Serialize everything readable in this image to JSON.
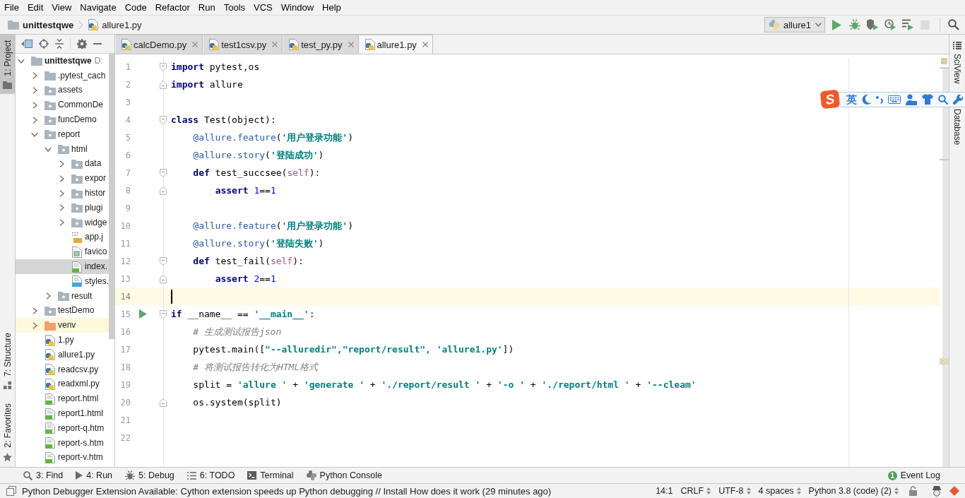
{
  "menu_bar": {
    "items": [
      "File",
      "Edit",
      "View",
      "Navigate",
      "Code",
      "Refactor",
      "Run",
      "Tools",
      "VCS",
      "Window",
      "Help"
    ]
  },
  "navigation_bar": {
    "breadcrumbs": [
      {
        "kind": "folder",
        "label": "unittestqwe"
      },
      {
        "kind": "python",
        "label": "allure1.py"
      }
    ],
    "run_configuration": {
      "label": "allure1"
    },
    "actions": [
      {
        "kind": "run",
        "disabled": false
      },
      {
        "kind": "debug",
        "disabled": false
      },
      {
        "kind": "coverage",
        "disabled": false
      },
      {
        "kind": "profile",
        "disabled": false
      },
      {
        "kind": "concurrency",
        "disabled": false
      },
      {
        "kind": "stop",
        "disabled": true
      },
      {
        "kind": "search",
        "disabled": false
      }
    ]
  },
  "left_stripe": [
    {
      "kind": "project",
      "label": "1: Project",
      "selected": true
    },
    {
      "kind": "structure",
      "label": "7: Structure",
      "selected": false
    },
    {
      "kind": "favorites",
      "label": "2: Favorites",
      "selected": false
    }
  ],
  "project_panel": {
    "tree": [
      {
        "kind": "folder",
        "label": "unittestqwe",
        "path": "D:",
        "expanded": true,
        "selected": false,
        "children": [
          {
            "kind": "folder",
            "label": ".pytest_cach",
            "expanded": false,
            "selected": false
          },
          {
            "kind": "package",
            "label": "assets",
            "expanded": false,
            "selected": false
          },
          {
            "kind": "package",
            "label": "CommonDe",
            "expanded": false,
            "selected": false
          },
          {
            "kind": "package",
            "label": "funcDemo",
            "expanded": false,
            "selected": false
          },
          {
            "kind": "package",
            "label": "report",
            "expanded": true,
            "selected": false,
            "children": [
              {
                "kind": "package",
                "label": "html",
                "expanded": true,
                "selected": false,
                "children": [
                  {
                    "kind": "package",
                    "label": "data",
                    "expanded": false,
                    "selected": false
                  },
                  {
                    "kind": "package",
                    "label": "expor",
                    "expanded": false,
                    "selected": false
                  },
                  {
                    "kind": "package",
                    "label": "histor",
                    "expanded": false,
                    "selected": false
                  },
                  {
                    "kind": "package",
                    "label": "plugi",
                    "expanded": false,
                    "selected": false
                  },
                  {
                    "kind": "package",
                    "label": "widge",
                    "expanded": false,
                    "selected": false
                  },
                  {
                    "kind": "js",
                    "label": "app.j",
                    "selected": false
                  },
                  {
                    "kind": "image",
                    "label": "favico",
                    "selected": false
                  },
                  {
                    "kind": "html",
                    "label": "index.",
                    "selected": true
                  },
                  {
                    "kind": "css",
                    "label": "styles.",
                    "selected": false
                  }
                ]
              },
              {
                "kind": "package",
                "label": "result",
                "expanded": false,
                "selected": false
              }
            ]
          },
          {
            "kind": "package",
            "label": "testDemo",
            "expanded": false,
            "selected": false
          },
          {
            "kind": "excluded",
            "label": "venv",
            "expanded": false,
            "selected": false
          },
          {
            "kind": "python",
            "label": "1.py",
            "selected": false
          },
          {
            "kind": "python",
            "label": "allure1.py",
            "selected": false
          },
          {
            "kind": "python",
            "label": "readcsv.py",
            "selected": false
          },
          {
            "kind": "python",
            "label": "readxml.py",
            "selected": false
          },
          {
            "kind": "html",
            "label": "report.html",
            "selected": false
          },
          {
            "kind": "html",
            "label": "report1.html",
            "selected": false
          },
          {
            "kind": "html",
            "label": "report-q.htm",
            "selected": false
          },
          {
            "kind": "html",
            "label": "report-s.htm",
            "selected": false
          },
          {
            "kind": "html",
            "label": "report-v.htm",
            "selected": false
          }
        ]
      }
    ]
  },
  "editor": {
    "tabs": [
      {
        "label": "calcDemo.py",
        "selected": false
      },
      {
        "label": "test1csv.py",
        "selected": false
      },
      {
        "label": "test_py.py",
        "selected": false
      },
      {
        "label": "allure1.py",
        "selected": true
      }
    ],
    "lines": [
      {
        "number": "1",
        "fold_start": true,
        "fold_end": false,
        "current": false,
        "runnable": false,
        "tokens": [
          {
            "kind": "keyword",
            "text": "import"
          },
          {
            "kind": "plain",
            "text": " pytest,os"
          }
        ]
      },
      {
        "number": "2",
        "fold_start": false,
        "fold_end": true,
        "current": false,
        "runnable": false,
        "tokens": [
          {
            "kind": "keyword",
            "text": "import"
          },
          {
            "kind": "plain",
            "text": " allure"
          }
        ]
      },
      {
        "number": "3",
        "fold_start": false,
        "fold_end": false,
        "current": false,
        "runnable": false
      },
      {
        "number": "4",
        "fold_start": true,
        "fold_end": false,
        "current": false,
        "runnable": false,
        "tokens": [
          {
            "kind": "keyword",
            "text": "class"
          },
          {
            "kind": "plain",
            "text": " Test(object):"
          }
        ]
      },
      {
        "number": "5",
        "fold_start": false,
        "fold_end": false,
        "current": false,
        "runnable": false,
        "tokens": [
          {
            "kind": "decorator",
            "text": "    @allure.feature"
          },
          {
            "kind": "plain",
            "text": "("
          },
          {
            "kind": "string",
            "text": "'用户登录功能'"
          },
          {
            "kind": "plain",
            "text": ")"
          }
        ]
      },
      {
        "number": "6",
        "fold_start": false,
        "fold_end": false,
        "current": false,
        "runnable": false,
        "tokens": [
          {
            "kind": "decorator",
            "text": "    @allure.story"
          },
          {
            "kind": "plain",
            "text": "("
          },
          {
            "kind": "string",
            "text": "'登陆成功'"
          },
          {
            "kind": "plain",
            "text": ")"
          }
        ]
      },
      {
        "number": "7",
        "fold_start": true,
        "fold_end": false,
        "current": false,
        "runnable": false,
        "tokens": [
          {
            "kind": "keyword",
            "text": "    def"
          },
          {
            "kind": "plain",
            "text": " test_succsee("
          },
          {
            "kind": "self",
            "text": "self"
          },
          {
            "kind": "plain",
            "text": "):"
          }
        ]
      },
      {
        "number": "8",
        "fold_start": false,
        "fold_end": true,
        "current": false,
        "runnable": false,
        "tokens": [
          {
            "kind": "keyword",
            "text": "        assert"
          },
          {
            "kind": "number",
            "text": " 1"
          },
          {
            "kind": "plain",
            "text": "=="
          },
          {
            "kind": "number",
            "text": "1"
          }
        ]
      },
      {
        "number": "9",
        "fold_start": false,
        "fold_end": false,
        "current": false,
        "runnable": false
      },
      {
        "number": "10",
        "fold_start": false,
        "fold_end": false,
        "current": false,
        "runnable": false,
        "tokens": [
          {
            "kind": "decorator",
            "text": "    @allure.feature"
          },
          {
            "kind": "plain",
            "text": "("
          },
          {
            "kind": "string",
            "text": "'用户登录功能'"
          },
          {
            "kind": "plain",
            "text": ")"
          }
        ]
      },
      {
        "number": "11",
        "fold_start": false,
        "fold_end": false,
        "current": false,
        "runnable": false,
        "tokens": [
          {
            "kind": "decorator",
            "text": "    @allure.story"
          },
          {
            "kind": "plain",
            "text": "("
          },
          {
            "kind": "string",
            "text": "'登陆失败'"
          },
          {
            "kind": "plain",
            "text": ")"
          }
        ]
      },
      {
        "number": "12",
        "fold_start": true,
        "fold_end": false,
        "current": false,
        "runnable": false,
        "tokens": [
          {
            "kind": "keyword",
            "text": "    def"
          },
          {
            "kind": "plain",
            "text": " test_fail("
          },
          {
            "kind": "self",
            "text": "self"
          },
          {
            "kind": "plain",
            "text": "):"
          }
        ]
      },
      {
        "number": "13",
        "fold_start": false,
        "fold_end": true,
        "current": false,
        "runnable": false,
        "tokens": [
          {
            "kind": "keyword",
            "text": "        assert"
          },
          {
            "kind": "number",
            "text": " 2"
          },
          {
            "kind": "plain",
            "text": "=="
          },
          {
            "kind": "number",
            "text": "1"
          }
        ]
      },
      {
        "number": "14",
        "fold_start": false,
        "fold_end": false,
        "current": true,
        "runnable": false
      },
      {
        "number": "15",
        "fold_start": true,
        "fold_end": false,
        "current": false,
        "runnable": true,
        "tokens": [
          {
            "kind": "keyword",
            "text": "if"
          },
          {
            "kind": "plain",
            "text": " __name__ == "
          },
          {
            "kind": "string",
            "text": "'__main__'"
          },
          {
            "kind": "plain",
            "text": ":"
          }
        ]
      },
      {
        "number": "16",
        "fold_start": false,
        "fold_end": false,
        "current": false,
        "runnable": false,
        "tokens": [
          {
            "kind": "comment",
            "text": "    # 生成测试报告json"
          }
        ]
      },
      {
        "number": "17",
        "fold_start": false,
        "fold_end": false,
        "current": false,
        "runnable": false,
        "tokens": [
          {
            "kind": "plain",
            "text": "    pytest.main(["
          },
          {
            "kind": "string",
            "text": "\"--alluredir\",\"report/result\", 'allure1.py'"
          },
          {
            "kind": "plain",
            "text": "])"
          }
        ]
      },
      {
        "number": "18",
        "fold_start": false,
        "fold_end": false,
        "current": false,
        "runnable": false,
        "tokens": [
          {
            "kind": "comment",
            "text": "    # 将测试报告转化为HTML格式"
          }
        ]
      },
      {
        "number": "19",
        "fold_start": false,
        "fold_end": false,
        "current": false,
        "runnable": false,
        "tokens": [
          {
            "kind": "plain",
            "text": "    split = "
          },
          {
            "kind": "string",
            "text": "'allure '"
          },
          {
            "kind": "plain",
            "text": " + "
          },
          {
            "kind": "string",
            "text": "'generate '"
          },
          {
            "kind": "plain",
            "text": " + "
          },
          {
            "kind": "string",
            "text": "'./report/result '"
          },
          {
            "kind": "plain",
            "text": " + "
          },
          {
            "kind": "string",
            "text": "'-o '"
          },
          {
            "kind": "plain",
            "text": " + "
          },
          {
            "kind": "string",
            "text": "'./report/html '"
          },
          {
            "kind": "plain",
            "text": " + "
          },
          {
            "kind": "string",
            "text": "'--cleam'"
          }
        ]
      },
      {
        "number": "20",
        "fold_start": false,
        "fold_end": true,
        "current": false,
        "runnable": false,
        "tokens": [
          {
            "kind": "plain",
            "text": "    os.system(split)"
          }
        ]
      },
      {
        "number": "21",
        "fold_start": false,
        "fold_end": false,
        "current": false,
        "runnable": false
      },
      {
        "number": "22",
        "fold_start": false,
        "fold_end": false,
        "current": false,
        "runnable": false
      }
    ]
  },
  "right_stripe": [
    {
      "kind": "sciview",
      "label": "SciView"
    },
    {
      "kind": "database",
      "label": "Database"
    }
  ],
  "ime_toolbar": {
    "logo": "S",
    "mode": "英"
  },
  "tool_window_bar": {
    "items": [
      {
        "kind": "find",
        "label": "3: Find"
      },
      {
        "kind": "run",
        "label": "4: Run"
      },
      {
        "kind": "debug",
        "label": "5: Debug"
      },
      {
        "kind": "todo",
        "label": "6: TODO"
      },
      {
        "kind": "terminal",
        "label": "Terminal"
      },
      {
        "kind": "python_console",
        "label": "Python Console"
      }
    ],
    "event_log": {
      "label": "Event Log",
      "badge": "1"
    }
  },
  "status_bar": {
    "message": "Python Debugger Extension Available: Cython extension speeds up Python debugging // Install How does it work (29 minutes ago)",
    "caret_position": "14:1",
    "widgets": [
      "CRLF",
      "UTF-8",
      "4 spaces",
      "Python 3.8 (code) (2)"
    ]
  }
}
